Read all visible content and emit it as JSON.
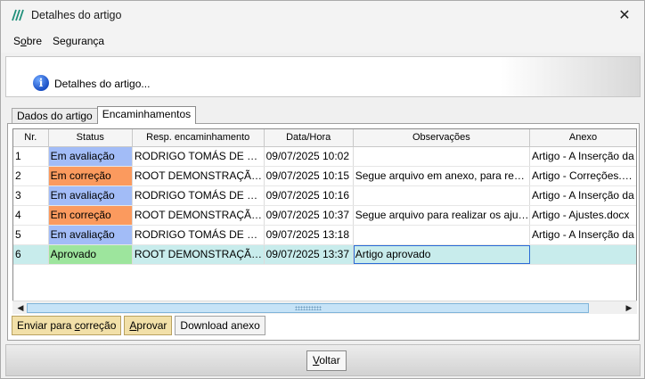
{
  "window": {
    "title": "Detalhes do artigo",
    "close_glyph": "✕"
  },
  "menu": [
    {
      "pre": "S",
      "ul": "o",
      "post": "bre"
    },
    {
      "pre": "Segurança",
      "ul": "",
      "post": ""
    }
  ],
  "banner": {
    "text": "Detalhes do artigo...",
    "icon": "info-icon"
  },
  "tabs": [
    {
      "label": "Dados do artigo",
      "active": false
    },
    {
      "label": "Encaminhamentos",
      "active": true
    }
  ],
  "table": {
    "columns": [
      "Nr.",
      "Status",
      "Resp. encaminhamento",
      "Data/Hora",
      "Observações",
      "Anexo"
    ],
    "rows": [
      {
        "nr": "1",
        "status": "Em avaliação",
        "status_type": "aval",
        "resp": "RODRIGO TOMÁS DE PAU...",
        "data": "09/07/2025 10:02",
        "obs": "",
        "anexo": "Artigo - A Inserção da"
      },
      {
        "nr": "2",
        "status": "Em correção",
        "status_type": "corr",
        "resp": "ROOT DEMONSTRAÇÃO J...",
        "data": "09/07/2025 10:15",
        "obs": "Segue arquivo em anexo, para reali...",
        "anexo": "Artigo - Correções.doc"
      },
      {
        "nr": "3",
        "status": "Em avaliação",
        "status_type": "aval",
        "resp": "RODRIGO TOMÁS DE PAU...",
        "data": "09/07/2025 10:16",
        "obs": "",
        "anexo": "Artigo - A Inserção da"
      },
      {
        "nr": "4",
        "status": "Em correção",
        "status_type": "corr",
        "resp": "ROOT DEMONSTRAÇÃO J...",
        "data": "09/07/2025 10:37",
        "obs": "Segue arquivo para realizar os ajust...",
        "anexo": "Artigo - Ajustes.docx"
      },
      {
        "nr": "5",
        "status": "Em avaliação",
        "status_type": "aval",
        "resp": "RODRIGO TOMÁS DE PAU...",
        "data": "09/07/2025 13:18",
        "obs": "",
        "anexo": "Artigo - A Inserção da"
      },
      {
        "nr": "6",
        "status": "Aprovado",
        "status_type": "apro",
        "resp": "ROOT DEMONSTRAÇÃO J...",
        "data": "09/07/2025 13:37",
        "obs": "Artigo aprovado",
        "anexo": "",
        "selected": true
      }
    ]
  },
  "actions": {
    "correcao": {
      "pre": "Enviar para ",
      "ul": "c",
      "post": "orreção"
    },
    "aprovar": {
      "pre": "",
      "ul": "A",
      "post": "provar"
    },
    "download": "Download anexo"
  },
  "footer": {
    "voltar": {
      "pre": "",
      "ul": "V",
      "post": "oltar"
    }
  },
  "colors": {
    "em_avaliacao": "#a2bcf7",
    "em_correcao": "#fb9a5e",
    "aprovado": "#9de59d",
    "selected_row": "#c8ecec",
    "action_button": "#f2e0a8"
  }
}
